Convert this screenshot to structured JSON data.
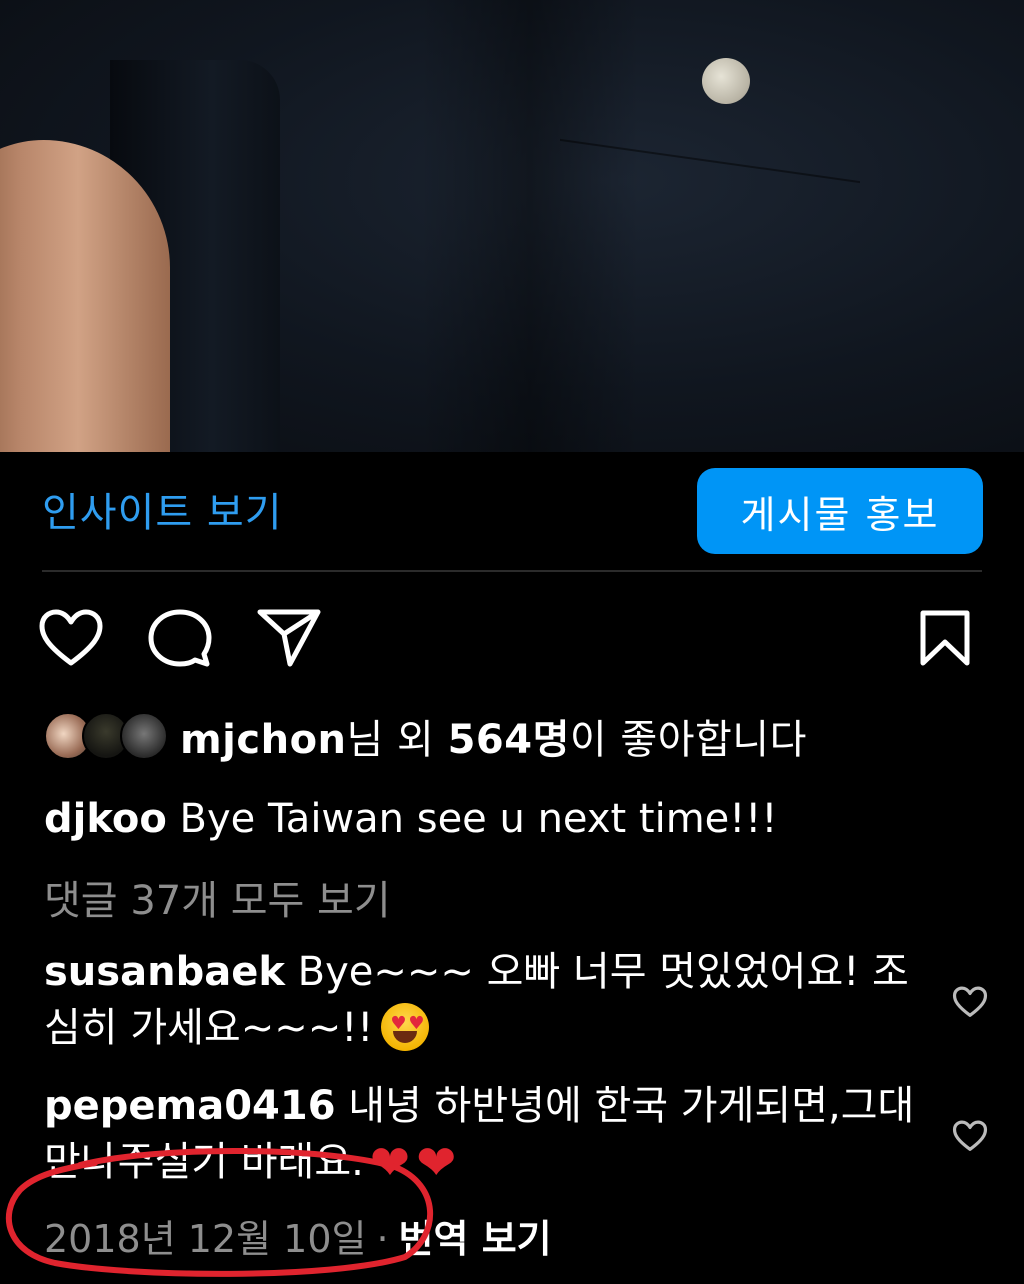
{
  "actions": {
    "insights_label": "인사이트 보기",
    "promote_label": "게시물 홍보"
  },
  "likes": {
    "username": "mjchon",
    "suffix_1": "님 외 ",
    "count": "564명",
    "suffix_2": "이 좋아합니다"
  },
  "caption": {
    "username": "djkoo",
    "text": " Bye Taiwan see u next time!!!"
  },
  "view_comments": "댓글 37개 모두 보기",
  "comments": [
    {
      "username": "susanbaek",
      "text": " Bye~~~ 오빠 너무 멋있었어요! 조심히 가세요~~~!!",
      "emoji": "heart-eyes"
    },
    {
      "username": "pepema0416",
      "text": " 내녕 하반녕에 한국 가게되면,그대 만나주실기 바래요.",
      "emoji": "red-hearts"
    }
  ],
  "meta": {
    "date": "2018년 12월 10일",
    "dot": "·",
    "translate": "번역 보기"
  },
  "colors": {
    "accent_blue": "#0095f6",
    "link_blue": "#2f9df0",
    "annotation_red": "#e0242e"
  }
}
